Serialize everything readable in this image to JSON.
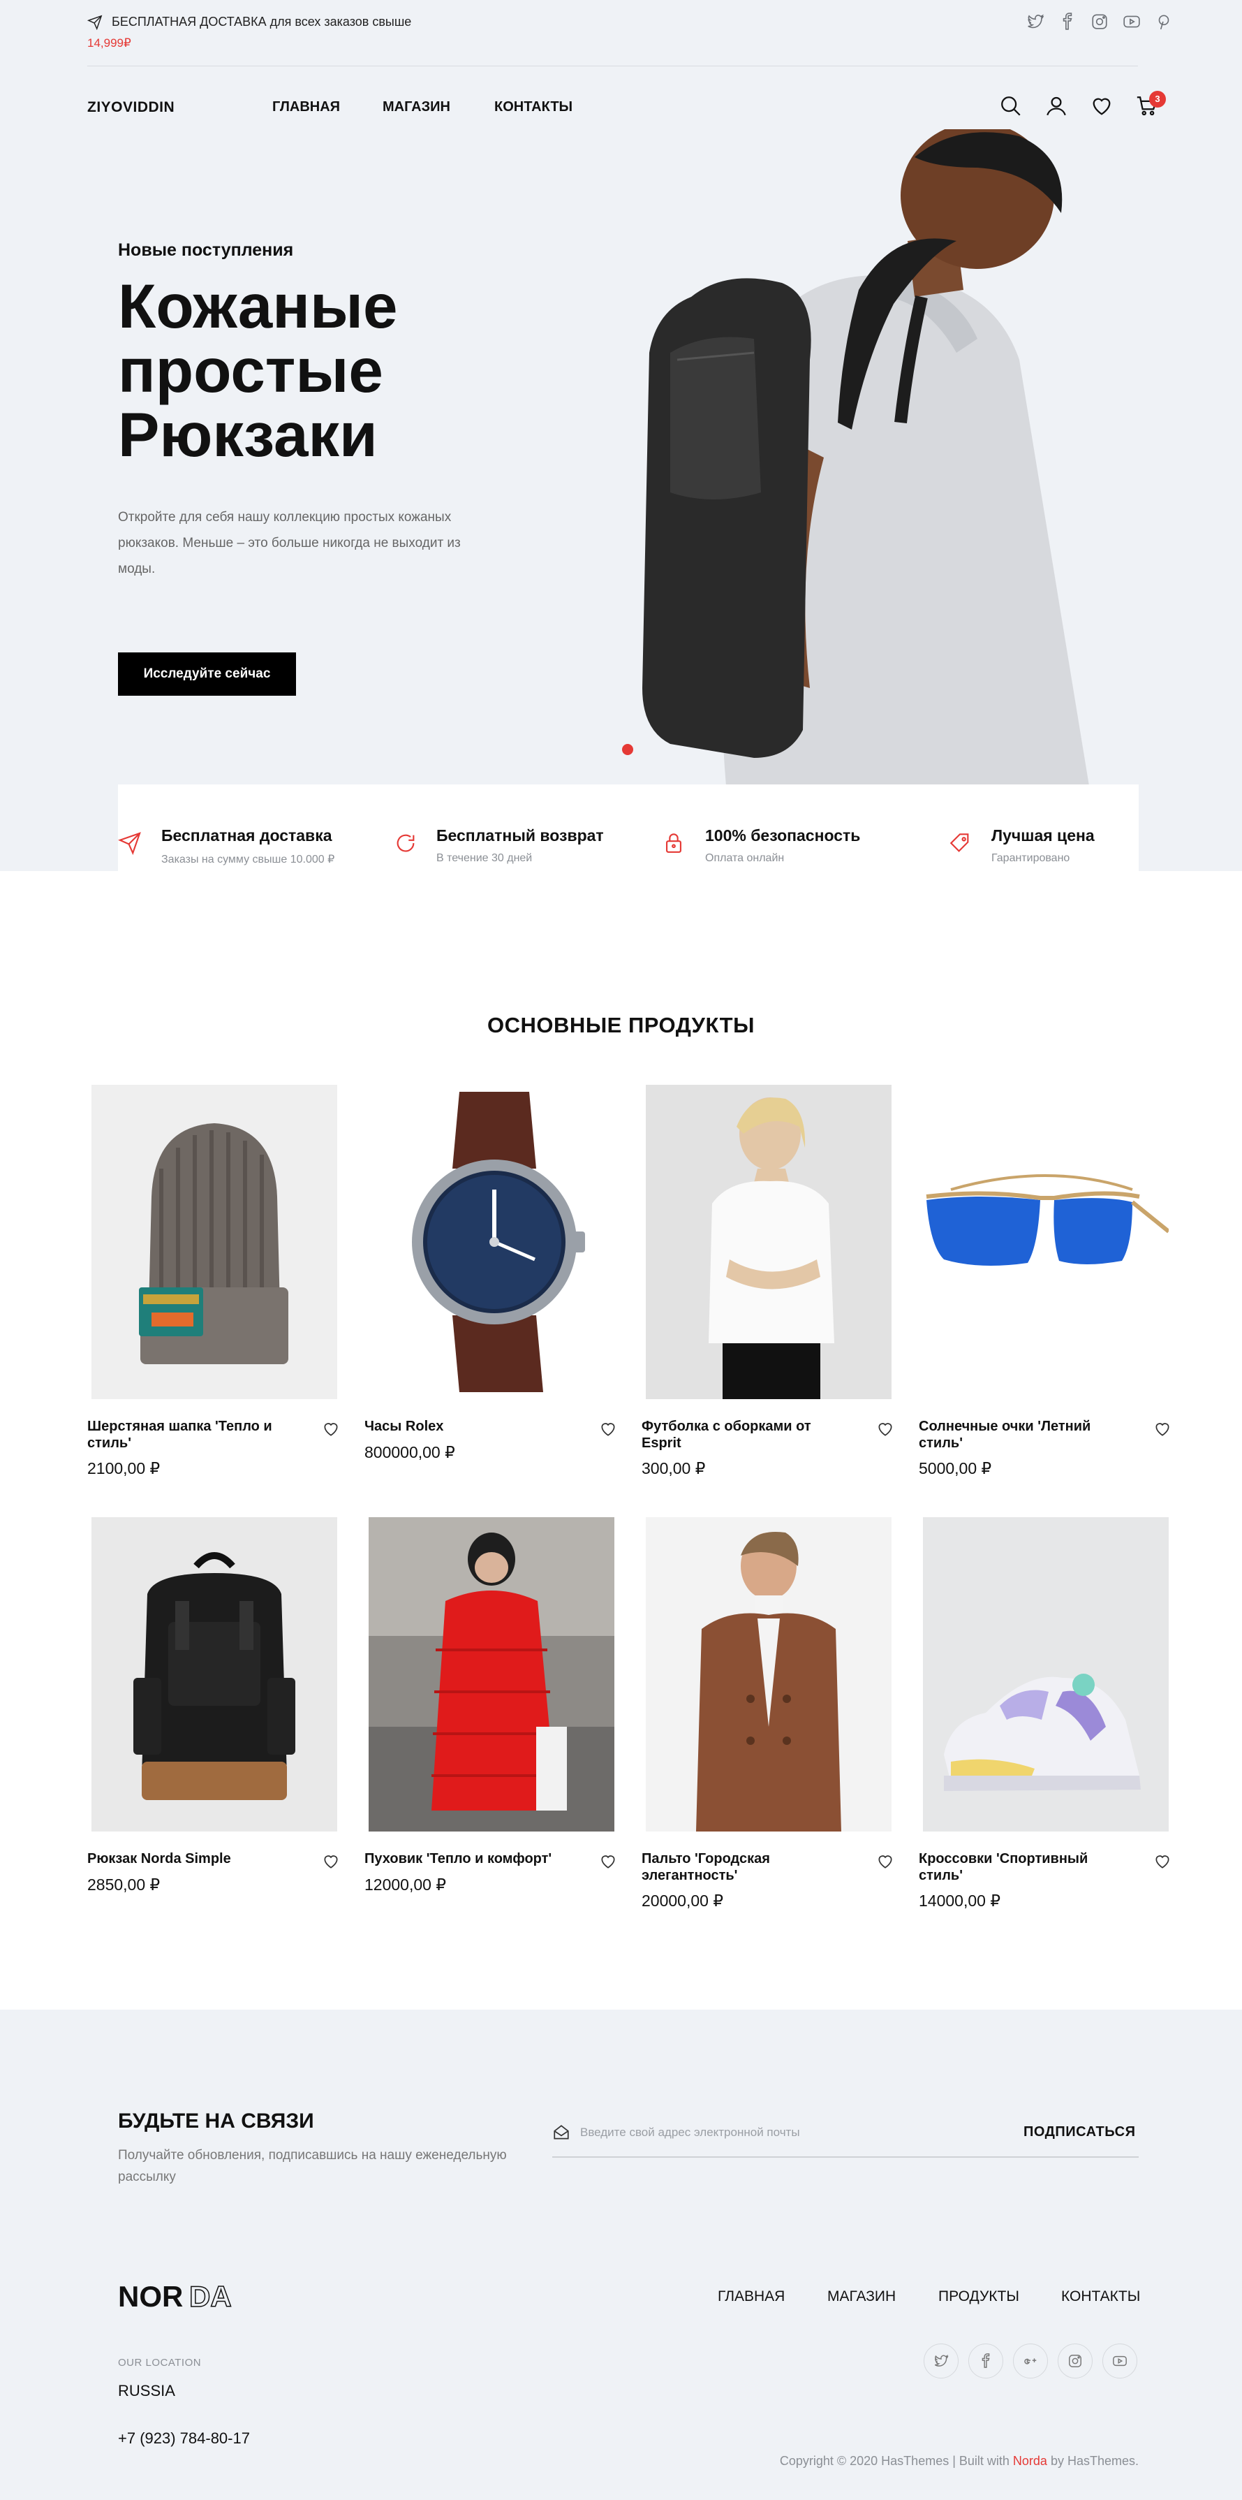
{
  "topbar": {
    "promo_text": "БЕСПЛАТНАЯ ДОСТАВКА для всех заказов свыше",
    "promo_price": "14,999₽",
    "social": [
      "twitter-icon",
      "facebook-icon",
      "instagram-icon",
      "youtube-icon",
      "pinterest-icon"
    ]
  },
  "header": {
    "logo": "ZIYOVIDDIN",
    "nav": [
      "ГЛАВНАЯ",
      "МАГАЗИН",
      "КОНТАКТЫ"
    ],
    "cart_count": "3"
  },
  "hero": {
    "eyebrow": "Новые поступления",
    "title": "Кожаные простые Рюкзаки",
    "description": "Откройте для себя нашу коллекцию простых кожаных рюкзаков. Меньше – это больше никогда не выходит из моды.",
    "cta": "Исследуйте сейчас"
  },
  "features": [
    {
      "title": "Бесплатная доставка",
      "subtitle": "Заказы на сумму свыше 10.000 ₽",
      "icon": "paper-plane-icon"
    },
    {
      "title": "Бесплатный возврат",
      "subtitle": "В течение 30 дней",
      "icon": "refresh-icon"
    },
    {
      "title": "100% безопасность",
      "subtitle": "Оплата онлайн",
      "icon": "lock-icon"
    },
    {
      "title": "Лучшая цена",
      "subtitle": "Гарантировано",
      "icon": "tag-icon"
    }
  ],
  "products": {
    "title": "ОСНОВНЫЕ ПРОДУКТЫ",
    "items": [
      {
        "name": "Шерстяная шапка 'Тепло и стиль'",
        "price": "2100,00 ₽"
      },
      {
        "name": "Часы Rolex",
        "price": "800000,00 ₽"
      },
      {
        "name": "Футболка с оборками от Esprit",
        "price": "300,00 ₽"
      },
      {
        "name": "Солнечные очки 'Летний стиль'",
        "price": "5000,00 ₽"
      },
      {
        "name": "Рюкзак Norda Simple",
        "price": "2850,00 ₽"
      },
      {
        "name": "Пуховик 'Тепло и комфорт'",
        "price": "12000,00 ₽"
      },
      {
        "name": "Пальто 'Городская элегантность'",
        "price": "20000,00 ₽"
      },
      {
        "name": "Кроссовки 'Спортивный стиль'",
        "price": "14000,00 ₽"
      }
    ]
  },
  "newsletter": {
    "title": "БУДЬТЕ НА СВЯЗИ",
    "description": "Получайте обновления, подписавшись на нашу еженедельную рассылку",
    "placeholder": "Введите свой адрес электронной почты",
    "submit": "ПОДПИСАТЬСЯ"
  },
  "footer": {
    "logo": "NORDA",
    "nav": [
      "ГЛАВНАЯ",
      "МАГАЗИН",
      "ПРОДУКТЫ",
      "КОНТАКТЫ"
    ],
    "location_label": "OUR LOCATION",
    "location": "RUSSIA",
    "phone": "+7 (923) 784-80-17",
    "copyright_prefix": "Copyright © 2020 HasThemes | Built with ",
    "copyright_brand": "Norda",
    "copyright_suffix": " by HasThemes.",
    "social": [
      "twitter-icon",
      "facebook-icon",
      "google-plus-icon",
      "instagram-icon",
      "youtube-icon"
    ]
  },
  "colors": {
    "accent": "#e53935",
    "hero_bg": "#eff2f6"
  }
}
